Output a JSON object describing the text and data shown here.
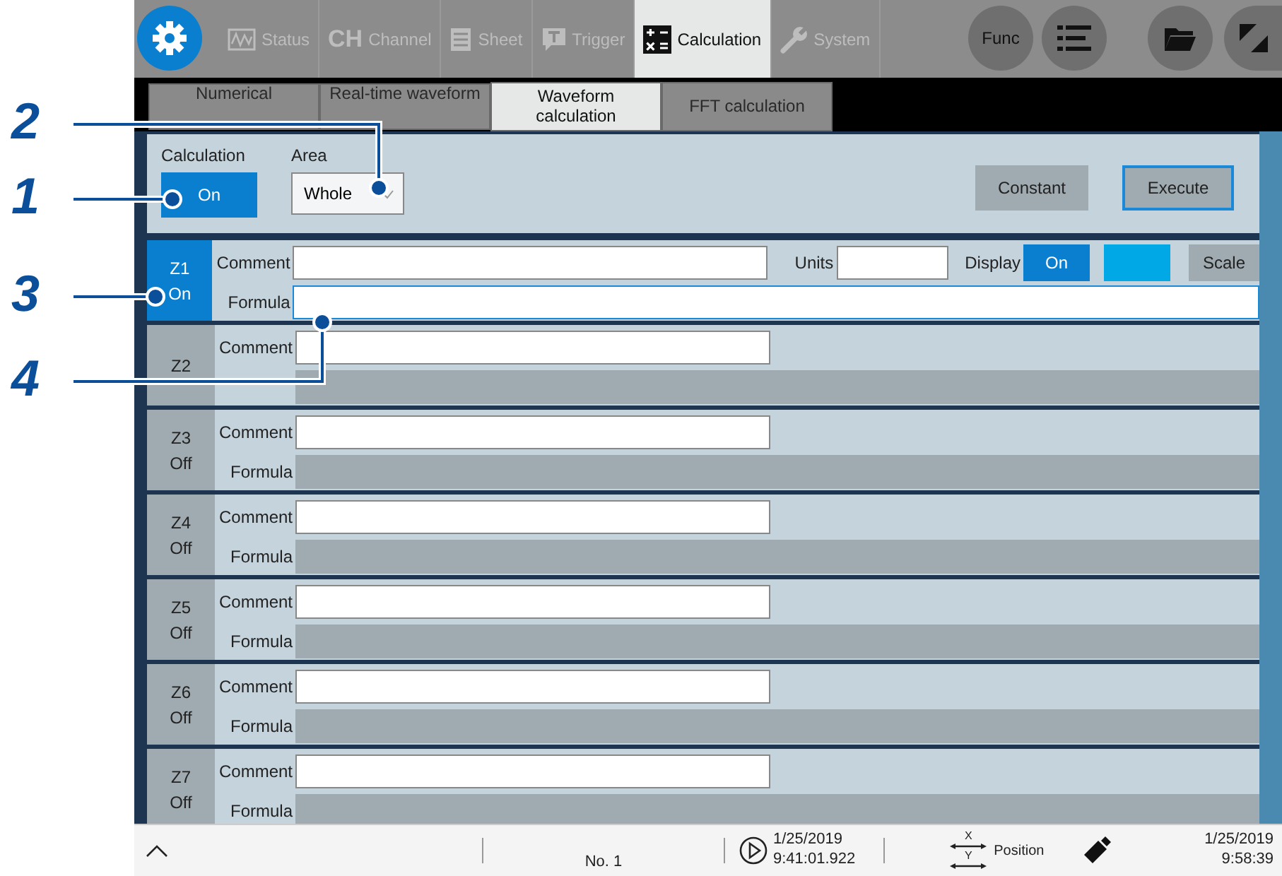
{
  "callouts": [
    {
      "label": "2"
    },
    {
      "label": "1"
    },
    {
      "label": "3"
    },
    {
      "label": "4"
    }
  ],
  "top_tabs": [
    {
      "label": "Status",
      "kind": "wave",
      "selected": false
    },
    {
      "label": "Channel",
      "kind": "text",
      "icon_text": "CH",
      "selected": false
    },
    {
      "label": "Sheet",
      "kind": "sheet",
      "selected": false
    },
    {
      "label": "Trigger",
      "kind": "trigger",
      "selected": false
    },
    {
      "label": "Calculation",
      "kind": "calc",
      "selected": true
    },
    {
      "label": "System",
      "kind": "wrench",
      "selected": false
    }
  ],
  "func_button": "Func",
  "sub_tabs": [
    {
      "label": "Numerical",
      "selected": false
    },
    {
      "label": "Real-time waveform",
      "selected": false
    },
    {
      "label": "Waveform calculation",
      "selected": true
    },
    {
      "label": "FFT calculation",
      "selected": false
    }
  ],
  "settings": {
    "calculation_label": "Calculation",
    "calculation_value": "On",
    "calculation_on": true,
    "area_label": "Area",
    "area_value": "Whole",
    "constant_button": "Constant",
    "execute_button": "Execute"
  },
  "rows": [
    {
      "name": "Z1",
      "state": "On",
      "on": true,
      "comment_label": "Comment",
      "formula_label": "Formula",
      "units_label": "Units",
      "display_label": "Display",
      "display_value": "On",
      "color": "#00a9e6",
      "scale_button": "Scale"
    },
    {
      "name": "Z2",
      "on": false,
      "comment_label": "Comment"
    },
    {
      "name": "Z3",
      "state": "Off",
      "on": false,
      "comment_label": "Comment",
      "formula_label": "Formula"
    },
    {
      "name": "Z4",
      "state": "Off",
      "on": false,
      "comment_label": "Comment",
      "formula_label": "Formula"
    },
    {
      "name": "Z5",
      "state": "Off",
      "on": false,
      "comment_label": "Comment",
      "formula_label": "Formula"
    },
    {
      "name": "Z6",
      "state": "Off",
      "on": false,
      "comment_label": "Comment",
      "formula_label": "Formula"
    },
    {
      "name": "Z7",
      "state": "Off",
      "on": false,
      "comment_label": "Comment",
      "formula_label": "Formula"
    }
  ],
  "status_bar": {
    "file_number": "No. 1",
    "trigger_date": "1/25/2019",
    "trigger_time": "9:41:01.922",
    "position_label": "Position",
    "x_axis": "X",
    "y_axis": "Y",
    "clock_date": "1/25/2019",
    "clock_time": "9:58:39"
  }
}
